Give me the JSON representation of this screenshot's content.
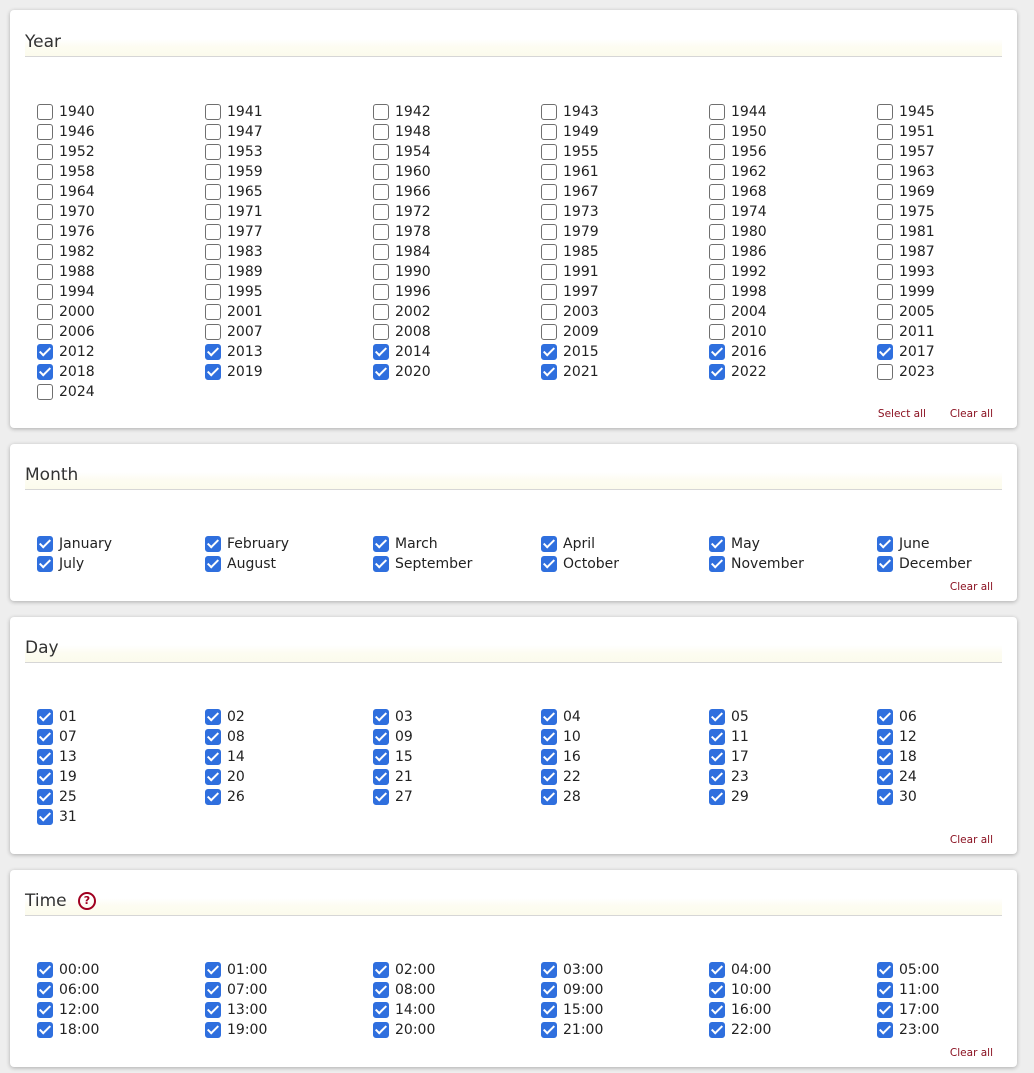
{
  "year": {
    "title": "Year",
    "select_all": "Select all",
    "clear_all": "Clear all",
    "items": [
      {
        "label": "1940",
        "checked": false
      },
      {
        "label": "1941",
        "checked": false
      },
      {
        "label": "1942",
        "checked": false
      },
      {
        "label": "1943",
        "checked": false
      },
      {
        "label": "1944",
        "checked": false
      },
      {
        "label": "1945",
        "checked": false
      },
      {
        "label": "1946",
        "checked": false
      },
      {
        "label": "1947",
        "checked": false
      },
      {
        "label": "1948",
        "checked": false
      },
      {
        "label": "1949",
        "checked": false
      },
      {
        "label": "1950",
        "checked": false
      },
      {
        "label": "1951",
        "checked": false
      },
      {
        "label": "1952",
        "checked": false
      },
      {
        "label": "1953",
        "checked": false
      },
      {
        "label": "1954",
        "checked": false
      },
      {
        "label": "1955",
        "checked": false
      },
      {
        "label": "1956",
        "checked": false
      },
      {
        "label": "1957",
        "checked": false
      },
      {
        "label": "1958",
        "checked": false
      },
      {
        "label": "1959",
        "checked": false
      },
      {
        "label": "1960",
        "checked": false
      },
      {
        "label": "1961",
        "checked": false
      },
      {
        "label": "1962",
        "checked": false
      },
      {
        "label": "1963",
        "checked": false
      },
      {
        "label": "1964",
        "checked": false
      },
      {
        "label": "1965",
        "checked": false
      },
      {
        "label": "1966",
        "checked": false
      },
      {
        "label": "1967",
        "checked": false
      },
      {
        "label": "1968",
        "checked": false
      },
      {
        "label": "1969",
        "checked": false
      },
      {
        "label": "1970",
        "checked": false
      },
      {
        "label": "1971",
        "checked": false
      },
      {
        "label": "1972",
        "checked": false
      },
      {
        "label": "1973",
        "checked": false
      },
      {
        "label": "1974",
        "checked": false
      },
      {
        "label": "1975",
        "checked": false
      },
      {
        "label": "1976",
        "checked": false
      },
      {
        "label": "1977",
        "checked": false
      },
      {
        "label": "1978",
        "checked": false
      },
      {
        "label": "1979",
        "checked": false
      },
      {
        "label": "1980",
        "checked": false
      },
      {
        "label": "1981",
        "checked": false
      },
      {
        "label": "1982",
        "checked": false
      },
      {
        "label": "1983",
        "checked": false
      },
      {
        "label": "1984",
        "checked": false
      },
      {
        "label": "1985",
        "checked": false
      },
      {
        "label": "1986",
        "checked": false
      },
      {
        "label": "1987",
        "checked": false
      },
      {
        "label": "1988",
        "checked": false
      },
      {
        "label": "1989",
        "checked": false
      },
      {
        "label": "1990",
        "checked": false
      },
      {
        "label": "1991",
        "checked": false
      },
      {
        "label": "1992",
        "checked": false
      },
      {
        "label": "1993",
        "checked": false
      },
      {
        "label": "1994",
        "checked": false
      },
      {
        "label": "1995",
        "checked": false
      },
      {
        "label": "1996",
        "checked": false
      },
      {
        "label": "1997",
        "checked": false
      },
      {
        "label": "1998",
        "checked": false
      },
      {
        "label": "1999",
        "checked": false
      },
      {
        "label": "2000",
        "checked": false
      },
      {
        "label": "2001",
        "checked": false
      },
      {
        "label": "2002",
        "checked": false
      },
      {
        "label": "2003",
        "checked": false
      },
      {
        "label": "2004",
        "checked": false
      },
      {
        "label": "2005",
        "checked": false
      },
      {
        "label": "2006",
        "checked": false
      },
      {
        "label": "2007",
        "checked": false
      },
      {
        "label": "2008",
        "checked": false
      },
      {
        "label": "2009",
        "checked": false
      },
      {
        "label": "2010",
        "checked": false
      },
      {
        "label": "2011",
        "checked": false
      },
      {
        "label": "2012",
        "checked": true
      },
      {
        "label": "2013",
        "checked": true
      },
      {
        "label": "2014",
        "checked": true
      },
      {
        "label": "2015",
        "checked": true
      },
      {
        "label": "2016",
        "checked": true
      },
      {
        "label": "2017",
        "checked": true
      },
      {
        "label": "2018",
        "checked": true
      },
      {
        "label": "2019",
        "checked": true
      },
      {
        "label": "2020",
        "checked": true
      },
      {
        "label": "2021",
        "checked": true
      },
      {
        "label": "2022",
        "checked": true
      },
      {
        "label": "2023",
        "checked": false
      },
      {
        "label": "2024",
        "checked": false
      }
    ]
  },
  "month": {
    "title": "Month",
    "clear_all": "Clear all",
    "items": [
      {
        "label": "January",
        "checked": true
      },
      {
        "label": "February",
        "checked": true
      },
      {
        "label": "March",
        "checked": true
      },
      {
        "label": "April",
        "checked": true
      },
      {
        "label": "May",
        "checked": true
      },
      {
        "label": "June",
        "checked": true
      },
      {
        "label": "July",
        "checked": true
      },
      {
        "label": "August",
        "checked": true
      },
      {
        "label": "September",
        "checked": true
      },
      {
        "label": "October",
        "checked": true
      },
      {
        "label": "November",
        "checked": true
      },
      {
        "label": "December",
        "checked": true
      }
    ]
  },
  "day": {
    "title": "Day",
    "clear_all": "Clear all",
    "items": [
      {
        "label": "01",
        "checked": true
      },
      {
        "label": "02",
        "checked": true
      },
      {
        "label": "03",
        "checked": true
      },
      {
        "label": "04",
        "checked": true
      },
      {
        "label": "05",
        "checked": true
      },
      {
        "label": "06",
        "checked": true
      },
      {
        "label": "07",
        "checked": true
      },
      {
        "label": "08",
        "checked": true
      },
      {
        "label": "09",
        "checked": true
      },
      {
        "label": "10",
        "checked": true
      },
      {
        "label": "11",
        "checked": true
      },
      {
        "label": "12",
        "checked": true
      },
      {
        "label": "13",
        "checked": true
      },
      {
        "label": "14",
        "checked": true
      },
      {
        "label": "15",
        "checked": true
      },
      {
        "label": "16",
        "checked": true
      },
      {
        "label": "17",
        "checked": true
      },
      {
        "label": "18",
        "checked": true
      },
      {
        "label": "19",
        "checked": true
      },
      {
        "label": "20",
        "checked": true
      },
      {
        "label": "21",
        "checked": true
      },
      {
        "label": "22",
        "checked": true
      },
      {
        "label": "23",
        "checked": true
      },
      {
        "label": "24",
        "checked": true
      },
      {
        "label": "25",
        "checked": true
      },
      {
        "label": "26",
        "checked": true
      },
      {
        "label": "27",
        "checked": true
      },
      {
        "label": "28",
        "checked": true
      },
      {
        "label": "29",
        "checked": true
      },
      {
        "label": "30",
        "checked": true
      },
      {
        "label": "31",
        "checked": true
      }
    ]
  },
  "time": {
    "title": "Time",
    "help_icon": "question-circle-icon",
    "help_glyph": "?",
    "clear_all": "Clear all",
    "items": [
      {
        "label": "00:00",
        "checked": true
      },
      {
        "label": "01:00",
        "checked": true
      },
      {
        "label": "02:00",
        "checked": true
      },
      {
        "label": "03:00",
        "checked": true
      },
      {
        "label": "04:00",
        "checked": true
      },
      {
        "label": "05:00",
        "checked": true
      },
      {
        "label": "06:00",
        "checked": true
      },
      {
        "label": "07:00",
        "checked": true
      },
      {
        "label": "08:00",
        "checked": true
      },
      {
        "label": "09:00",
        "checked": true
      },
      {
        "label": "10:00",
        "checked": true
      },
      {
        "label": "11:00",
        "checked": true
      },
      {
        "label": "12:00",
        "checked": true
      },
      {
        "label": "13:00",
        "checked": true
      },
      {
        "label": "14:00",
        "checked": true
      },
      {
        "label": "15:00",
        "checked": true
      },
      {
        "label": "16:00",
        "checked": true
      },
      {
        "label": "17:00",
        "checked": true
      },
      {
        "label": "18:00",
        "checked": true
      },
      {
        "label": "19:00",
        "checked": true
      },
      {
        "label": "20:00",
        "checked": true
      },
      {
        "label": "21:00",
        "checked": true
      },
      {
        "label": "22:00",
        "checked": true
      },
      {
        "label": "23:00",
        "checked": true
      }
    ]
  },
  "colors": {
    "checkbox_checked": "#2f6fde",
    "link": "#8a1020",
    "help_icon": "#a00020",
    "title_band": "#fcfbec"
  }
}
